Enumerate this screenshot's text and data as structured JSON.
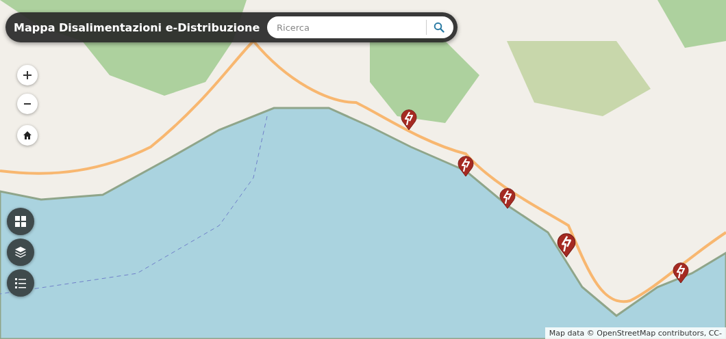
{
  "header": {
    "title": "Mappa Disalimentazioni e-Distribuzione"
  },
  "search": {
    "placeholder": "Ricerca"
  },
  "attribution": "Map data © OpenStreetMap contributors, CC-"
}
